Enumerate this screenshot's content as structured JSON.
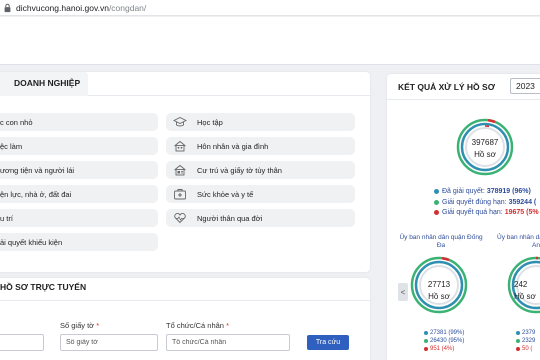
{
  "browser": {
    "url_host": "dichvucong.hanoi.gov.vn",
    "url_path": "/congdan/"
  },
  "services": {
    "tab_label": "DOANH NGHIỆP",
    "left_items": [
      "c con nhỏ",
      "ệc làm",
      "ương tiện và người lái",
      "ện lực, nhà ở, đất đai",
      "u trí",
      "ải quyết khiếu kiện"
    ],
    "right_items": [
      {
        "label": "Học tập",
        "icon": "graduation-cap-icon"
      },
      {
        "label": "Hôn nhân và gia đình",
        "icon": "family-house-icon"
      },
      {
        "label": "Cư trú và giấy tờ tùy thân",
        "icon": "id-card-icon"
      },
      {
        "label": "Sức khỏe và y tế",
        "icon": "medical-kit-icon"
      },
      {
        "label": "Người thân qua đời",
        "icon": "heart-icon"
      }
    ]
  },
  "lookup": {
    "title": "HỒ SƠ TRỰC TUYẾN",
    "field_doc_label": "Số giấy tờ",
    "field_doc_placeholder": "Số giấy tờ",
    "field_org_label": "Tổ chức/Cá nhân",
    "field_org_placeholder": "Tổ chức/Cá nhân",
    "required_mark": "*",
    "search_button": "Tra cứu"
  },
  "results": {
    "title": "KẾT QUẢ XỬ LÝ HỒ SƠ",
    "year": "2023",
    "main": {
      "total": "397687",
      "unit": "Hồ sơ",
      "legend": [
        {
          "label": "Đã giải quyết:",
          "value": "378919 (96%)",
          "color": "#2e8fb0"
        },
        {
          "label": "Giải quyết đúng hạn:",
          "value": "359244 (",
          "color": "#3bb273"
        },
        {
          "label": "Giải quyết quá hạn:",
          "value": "19675 (5%",
          "color": "#d32f2f"
        }
      ],
      "percent_resolved": 0.96,
      "percent_overdue": 0.05
    },
    "org1": {
      "name_line1": "Ủy ban nhân dân quận Đống",
      "name_line2": "Đa",
      "total": "27713",
      "unit": "Hồ sơ",
      "legend": [
        {
          "value": "27381 (99%)",
          "color": "#2e8fb0"
        },
        {
          "value": "26430 (95%)",
          "color": "#3bb273"
        },
        {
          "value": "951 (4%)",
          "color": "#d32f2f"
        }
      ]
    },
    "org2": {
      "name_line1": "Ủy ban nhân dân",
      "name_line2": "An",
      "total": "242",
      "unit": "Hồ sơ",
      "legend": [
        {
          "value": "2379",
          "color": "#2e8fb0"
        },
        {
          "value": "2329",
          "color": "#3bb273"
        },
        {
          "value": "50 (",
          "color": "#d32f2f"
        }
      ]
    },
    "prev_arrow": "<"
  }
}
